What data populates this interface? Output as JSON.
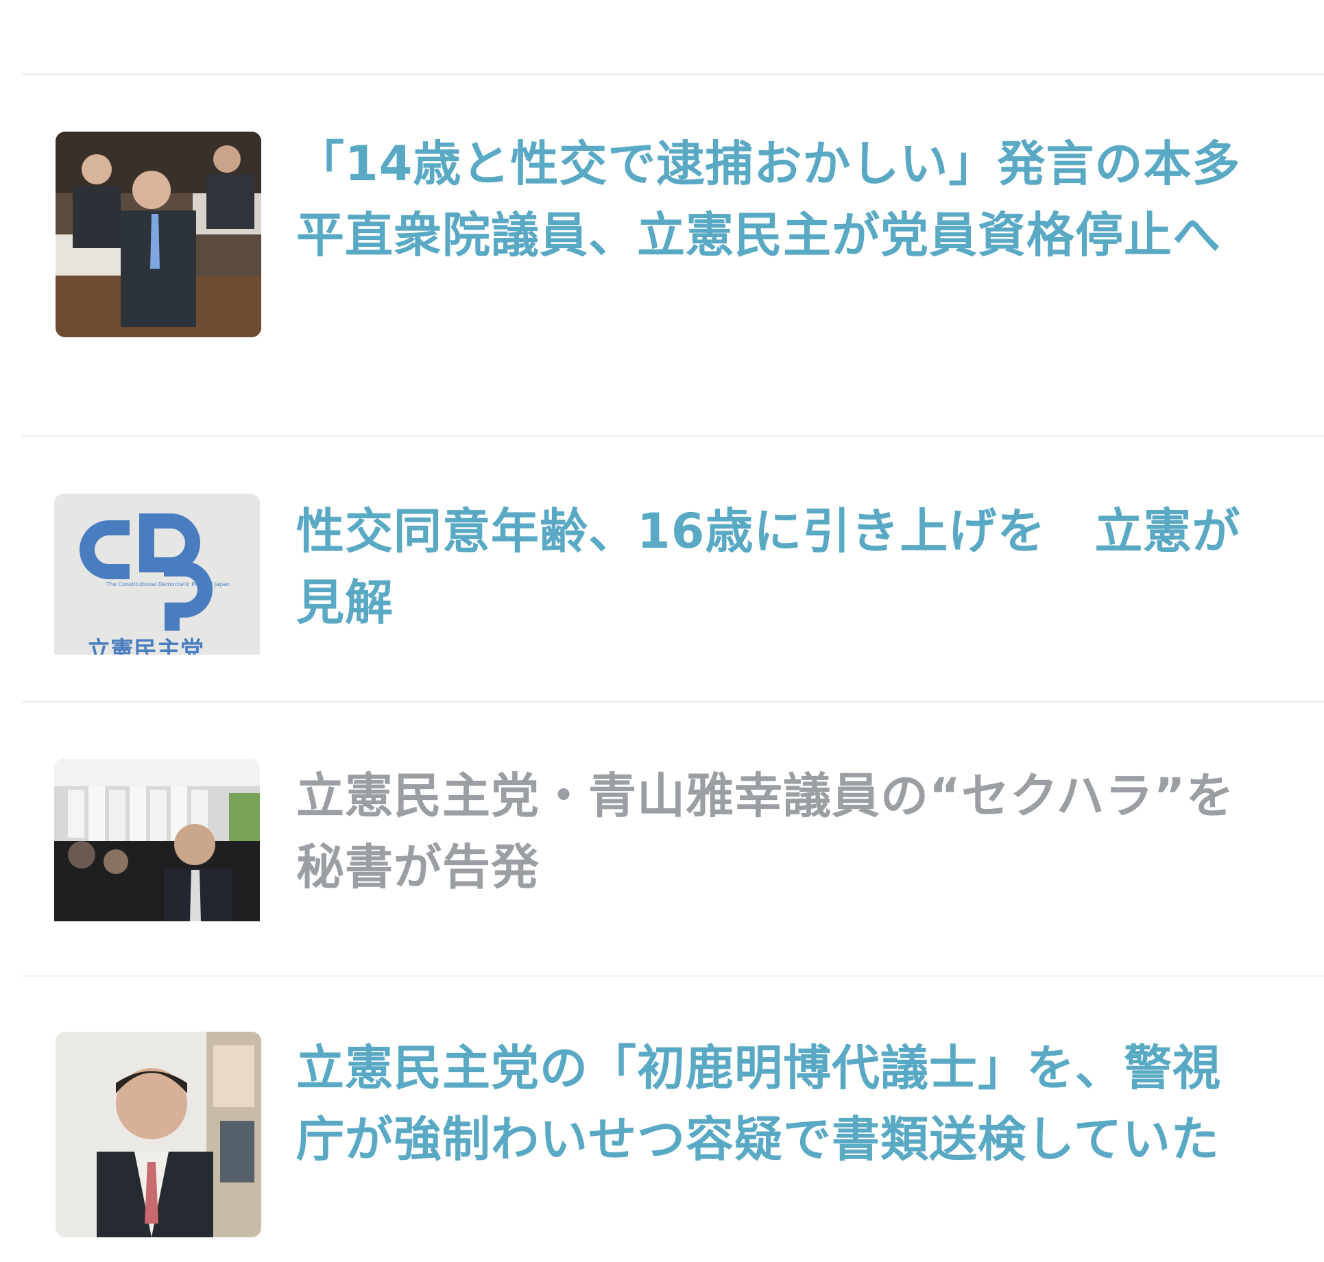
{
  "colors": {
    "link": "#5aa9c4",
    "visited": "#9b9fa3",
    "divider": "#f1f1f1"
  },
  "articles": [
    {
      "title": "「14歳と性交で逮捕おかしい」発言の本多平直衆院議員、立憲民主が党員資格停止へ",
      "state": "unread",
      "thumb_icon": "politician-photo-thumbnail"
    },
    {
      "title": "性交同意年齢、16歳に引き上げを　立憲が見解",
      "state": "unread",
      "thumb_icon": "cdp-logo-thumbnail",
      "thumb_text": {
        "logo_letters": "CDP",
        "logo_english": "The Constitutional Democratic Party of Japan",
        "logo_japanese": "立憲民主党"
      }
    },
    {
      "title": "立憲民主党・青山雅幸議員の“セクハラ”を秘書が告発",
      "state": "visited",
      "thumb_icon": "press-conference-photo-thumbnail"
    },
    {
      "title": "立憲民主党の「初鹿明博代議士」を、警視庁が強制わいせつ容疑で書類送検していた",
      "state": "unread",
      "thumb_icon": "politician-portrait-thumbnail"
    }
  ]
}
